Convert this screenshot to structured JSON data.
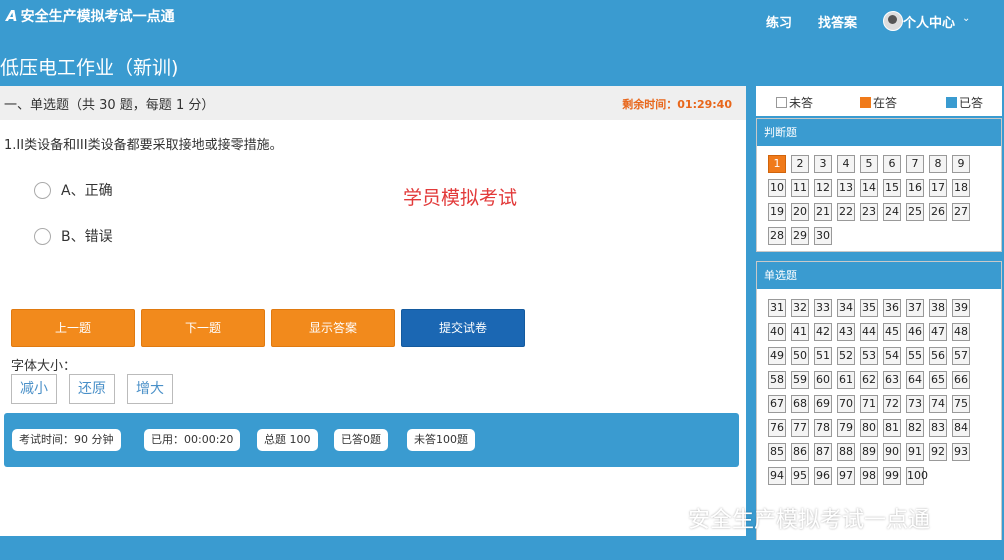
{
  "header": {
    "logo_mark": "A",
    "logo_text": "安全生产模拟考试一点通",
    "nav": {
      "practice": "练习",
      "find_answer": "找答案",
      "user_center": "个人中心"
    },
    "chevron": "⌄"
  },
  "page_title": "低压电工作业（新训)",
  "section": {
    "title": "一、单选题（共 30 题，每题 1 分）",
    "timer": "剩余时间：01:29:40"
  },
  "question": {
    "text": "1.II类设备和III类设备都要采取接地或接零措施。",
    "options": [
      "A、正确",
      "B、错误"
    ]
  },
  "overlay_text": "学员模拟考试",
  "buttons": {
    "prev": "上一题",
    "next": "下一题",
    "show_answer": "显示答案",
    "submit": "提交试卷"
  },
  "font_size": {
    "label": "字体大小：",
    "decrease": "减小",
    "reset": "还原",
    "increase": "增大"
  },
  "status": {
    "exam_time": "考试时间：90 分钟",
    "elapsed": "已用：00:00:20",
    "total": "总题 100",
    "answered": "已答0题",
    "unanswered": "未答100题"
  },
  "legend": {
    "unanswered": "未答",
    "current": "在答",
    "answered": "已答"
  },
  "colors": {
    "unanswered": "#ffffff",
    "current": "#f07a1a",
    "answered": "#3a9bd0",
    "header": "#3a9bd0"
  },
  "judge_panel": {
    "title": "判断题",
    "numbers": [
      "1",
      "2",
      "3",
      "4",
      "5",
      "6",
      "7",
      "8",
      "9",
      "10",
      "11",
      "12",
      "13",
      "14",
      "15",
      "16",
      "17",
      "18",
      "19",
      "20",
      "21",
      "22",
      "23",
      "24",
      "25",
      "26",
      "27",
      "28",
      "29",
      "30"
    ],
    "current": "1"
  },
  "single_panel": {
    "title": "单选题",
    "numbers": [
      "31",
      "32",
      "33",
      "34",
      "35",
      "36",
      "37",
      "38",
      "39",
      "40",
      "41",
      "42",
      "43",
      "44",
      "45",
      "46",
      "47",
      "48",
      "49",
      "50",
      "51",
      "52",
      "53",
      "54",
      "55",
      "56",
      "57",
      "58",
      "59",
      "60",
      "61",
      "62",
      "63",
      "64",
      "65",
      "66",
      "67",
      "68",
      "69",
      "70",
      "71",
      "72",
      "73",
      "74",
      "75",
      "76",
      "77",
      "78",
      "79",
      "80",
      "81",
      "82",
      "83",
      "84",
      "85",
      "86",
      "87",
      "88",
      "89",
      "90",
      "91",
      "92",
      "93",
      "94",
      "95",
      "96",
      "97",
      "98",
      "99",
      "100"
    ]
  },
  "wechat_watermark": "安全生产模拟考试一点通"
}
